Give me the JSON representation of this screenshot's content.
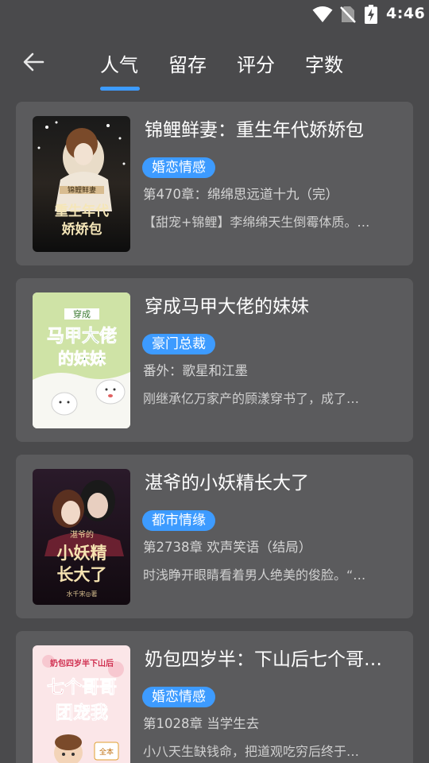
{
  "status_bar": {
    "time": "4:46",
    "icons": [
      "wifi-icon",
      "no-sim-icon",
      "battery-charging-icon"
    ]
  },
  "header": {
    "back_icon": "arrow-left-icon",
    "tabs": [
      {
        "label": "人气",
        "active": true
      },
      {
        "label": "留存",
        "active": false
      },
      {
        "label": "评分",
        "active": false
      },
      {
        "label": "字数",
        "active": false
      }
    ],
    "accent_color": "#3d9bff"
  },
  "books": [
    {
      "title": "锦鲤鲜妻：重生年代娇娇包",
      "tag": "婚恋情感",
      "chapter": "第470章：绵绵思远道十九（完）",
      "description": "【甜宠+锦鲤】李绵绵天生倒霉体质。…",
      "cover_text_main": "重生年代娇娇包",
      "cover_text_top": "锦鲤鲜妻"
    },
    {
      "title": "穿成马甲大佬的妹妹",
      "tag": "豪门总裁",
      "chapter": "番外：歌星和江墨",
      "description": "刚继承亿万家产的顾漾穿书了，成了…",
      "cover_text_main": "马甲大佬的妹妹",
      "cover_text_top": "穿成"
    },
    {
      "title": "湛爷的小妖精长大了",
      "tag": "都市情缘",
      "chapter": "第2738章 欢声笑语（结局）",
      "description": "时浅睁开眼睛看着男人绝美的俊脸。“…",
      "cover_text_main": "小妖精长大了",
      "cover_text_top": "湛爷的",
      "cover_author": "水千宋◎著"
    },
    {
      "title": "奶包四岁半：下山后七个哥…",
      "tag": "婚恋情感",
      "chapter": "第1028章 当学生去",
      "description": "小八天生缺钱命，把道观吃穷后终于…",
      "cover_text_main": "七个哥哥团宠我",
      "cover_text_top": "奶包四岁半下山后"
    }
  ]
}
